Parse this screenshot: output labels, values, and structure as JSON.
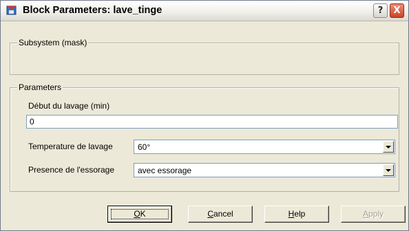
{
  "window": {
    "title": "Block Parameters: lave_tinge",
    "help_glyph": "?",
    "close_glyph": "X"
  },
  "subsystem": {
    "label": "Subsystem (mask)"
  },
  "parameters": {
    "label": "Parameters",
    "start_label": "Début du lavage (min)",
    "start_value": "0",
    "temperature_label": "Temperature de lavage",
    "temperature_value": "60°",
    "spin_label": "Presence de l'essorage",
    "spin_value": "avec essorage"
  },
  "buttons": {
    "ok": {
      "mnemonic": "O",
      "rest": "K"
    },
    "cancel": {
      "mnemonic": "C",
      "rest": "ancel"
    },
    "help": {
      "mnemonic": "H",
      "rest": "elp"
    },
    "apply": {
      "mnemonic": "A",
      "rest": "pply"
    }
  },
  "colors": {
    "dialog_bg": "#ece9d8",
    "close_red": "#c9432a",
    "input_border": "#7f9db9"
  }
}
